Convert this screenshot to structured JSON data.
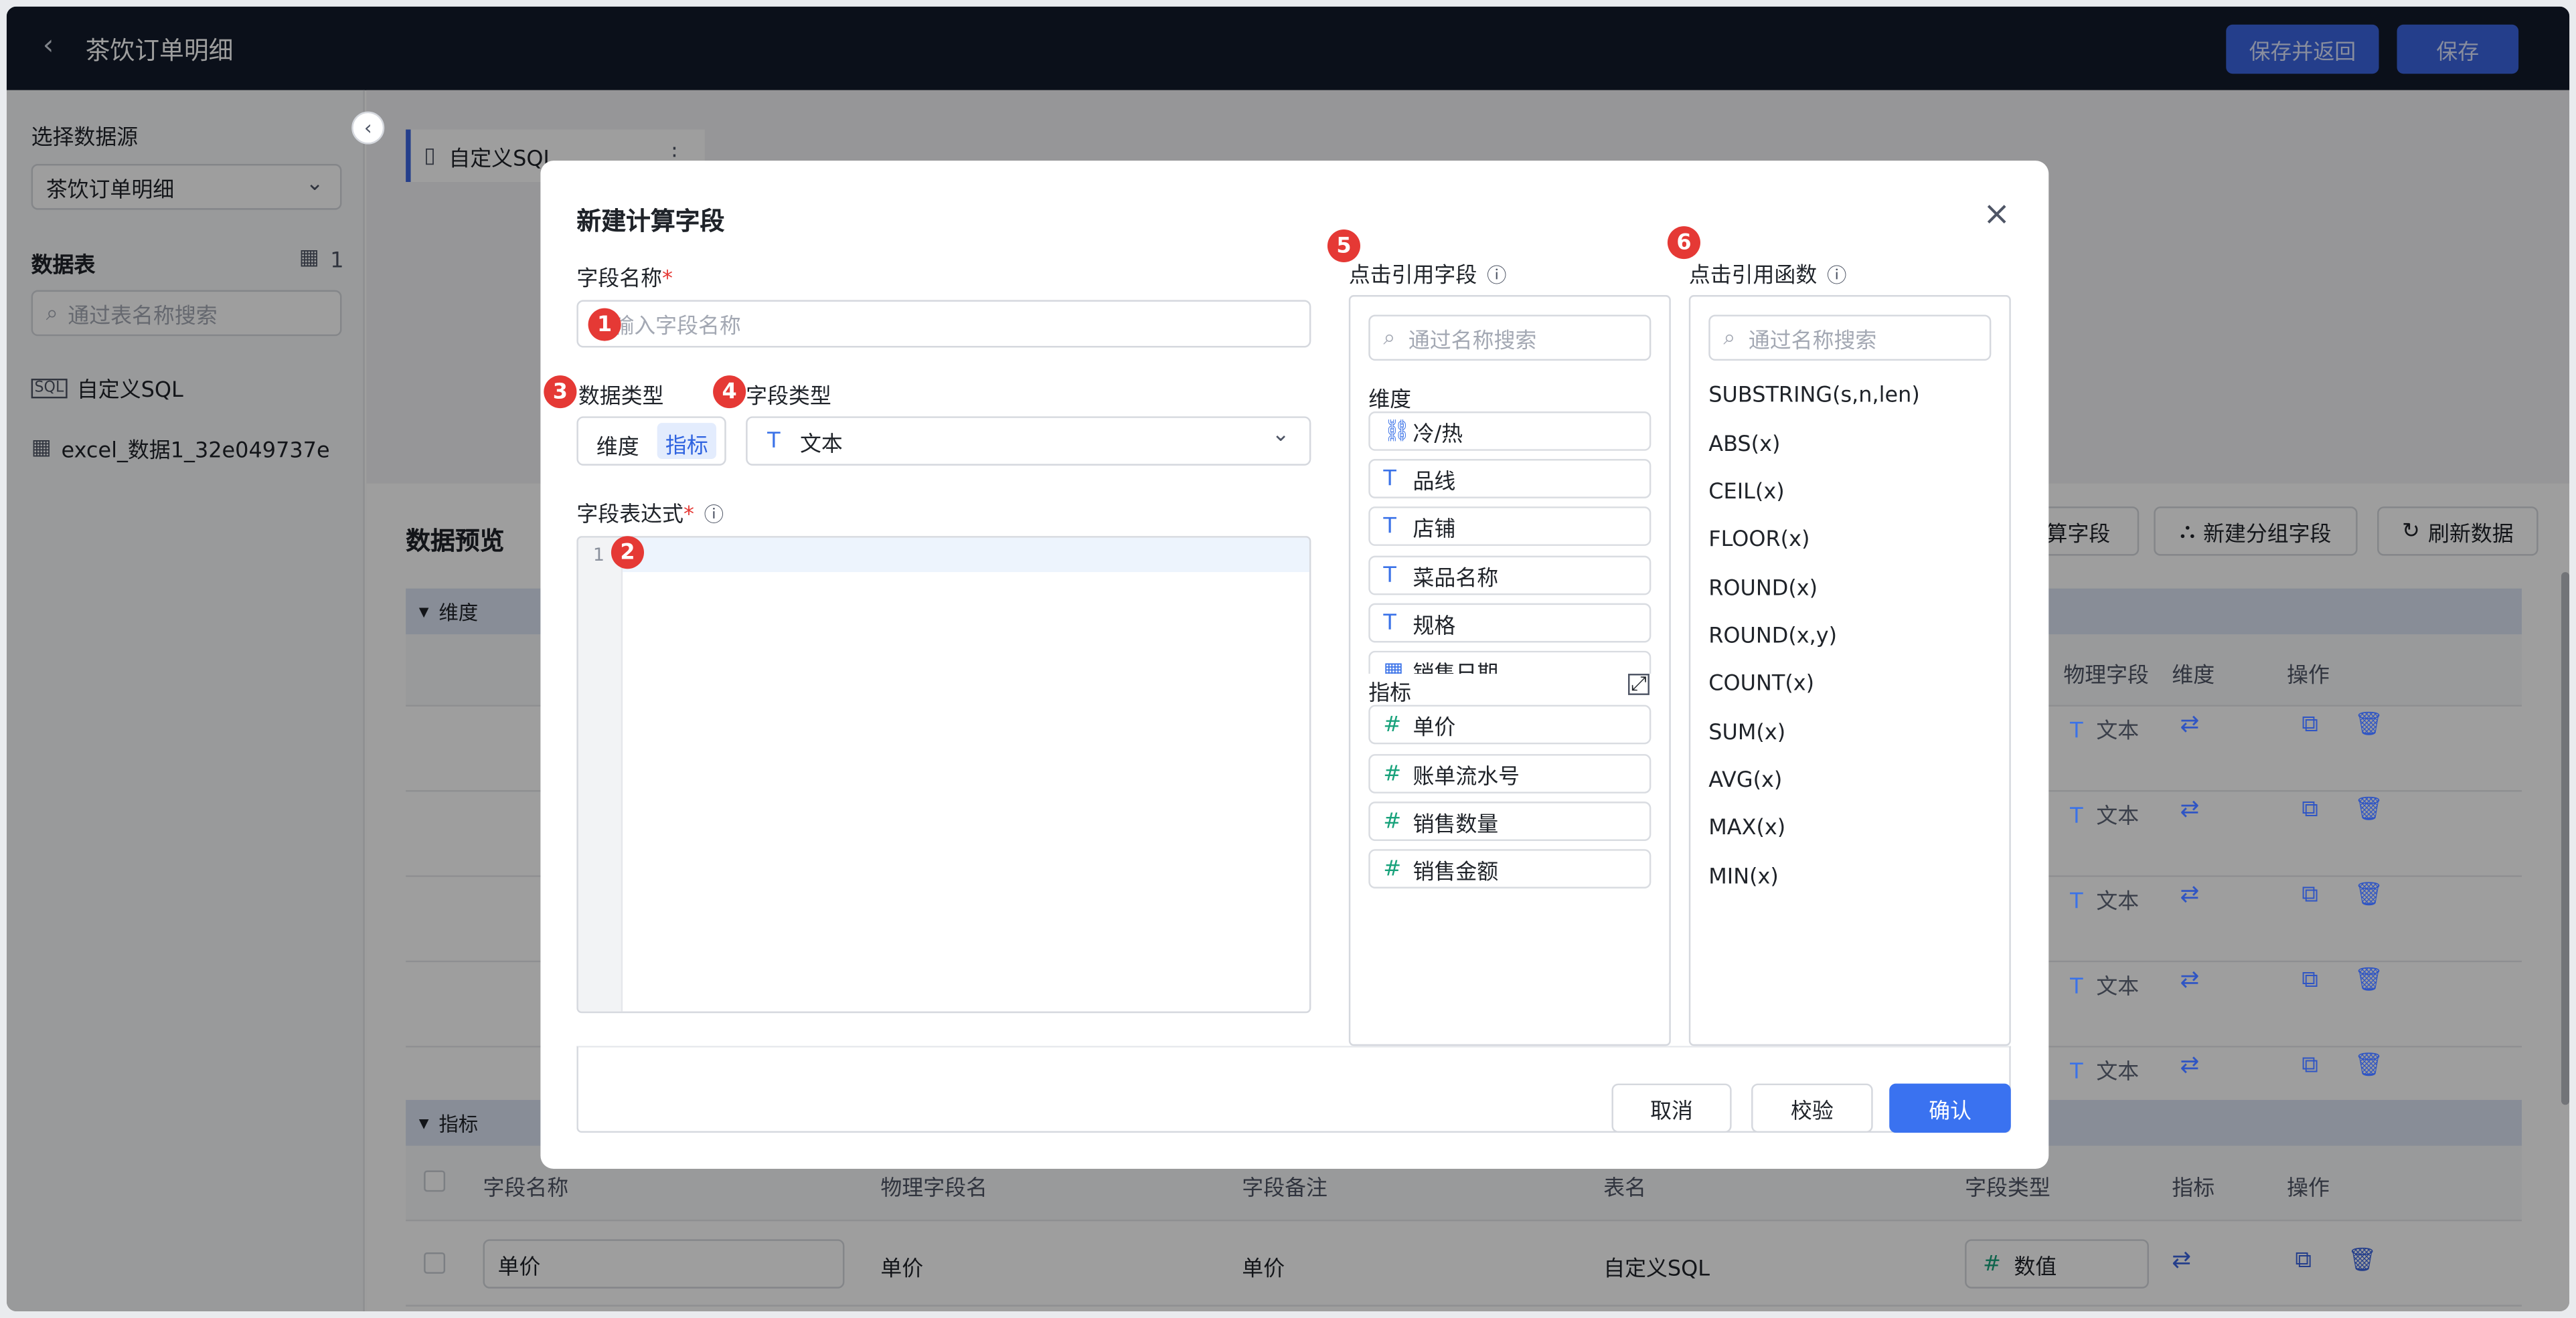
{
  "topbar": {
    "title": "茶饮订单明细",
    "save_return": "保存并返回",
    "save": "保存"
  },
  "sidebar": {
    "datasource_label": "选择数据源",
    "datasource_value": "茶饮订单明细",
    "tables_label": "数据表",
    "tables_count": "1",
    "search_placeholder": "通过表名称搜索",
    "items": [
      {
        "label": "自定义SQL"
      },
      {
        "label": "excel_数据1_32e049737e"
      }
    ]
  },
  "main": {
    "tab_label": "自定义SQL",
    "preview_title": "数据预览",
    "btn_calc": "算字段",
    "btn_group": "新建分组字段",
    "btn_refresh": "刷新数据",
    "dim_section": "维度",
    "metric_section": "指标",
    "dim_headers": {
      "phys": "物理字段",
      "dim": "维度",
      "op": "操作"
    },
    "dim_type_label": "文本",
    "metric_headers": {
      "name": "字段名称",
      "phys": "物理字段名",
      "note": "字段备注",
      "table": "表名",
      "type": "字段类型",
      "metric": "指标",
      "op": "操作"
    },
    "metric_row": {
      "name": "单价",
      "phys": "单价",
      "note": "单价",
      "table": "自定义SQL",
      "type": "数值"
    }
  },
  "modal": {
    "title": "新建计算字段",
    "field_name_label": "字段名称",
    "field_name_placeholder": "请输入字段名称",
    "data_type_label": "数据类型",
    "data_type_options": [
      "维度",
      "指标"
    ],
    "data_type_selected": "指标",
    "field_type_label": "字段类型",
    "field_type_value": "文本",
    "expr_label": "字段表达式",
    "line_no": "1",
    "ref_fields_label": "点击引用字段",
    "ref_fields_search": "通过名称搜索",
    "dim_group": "维度",
    "dim_fields": [
      "冷/热",
      "品线",
      "店铺",
      "菜品名称",
      "规格",
      "销售日期"
    ],
    "metric_group": "指标",
    "metric_fields": [
      "单价",
      "账单流水号",
      "销售数量",
      "销售金额"
    ],
    "ref_funcs_label": "点击引用函数",
    "ref_funcs_search": "通过名称搜索",
    "functions": [
      "SUBSTRING(s,n,len)",
      "ABS(x)",
      "CEIL(x)",
      "FLOOR(x)",
      "ROUND(x)",
      "ROUND(x,y)",
      "COUNT(x)",
      "SUM(x)",
      "AVG(x)",
      "MAX(x)",
      "MIN(x)"
    ],
    "cancel": "取消",
    "validate": "校验",
    "confirm": "确认",
    "badges": [
      "1",
      "2",
      "3",
      "4",
      "5",
      "6"
    ]
  }
}
